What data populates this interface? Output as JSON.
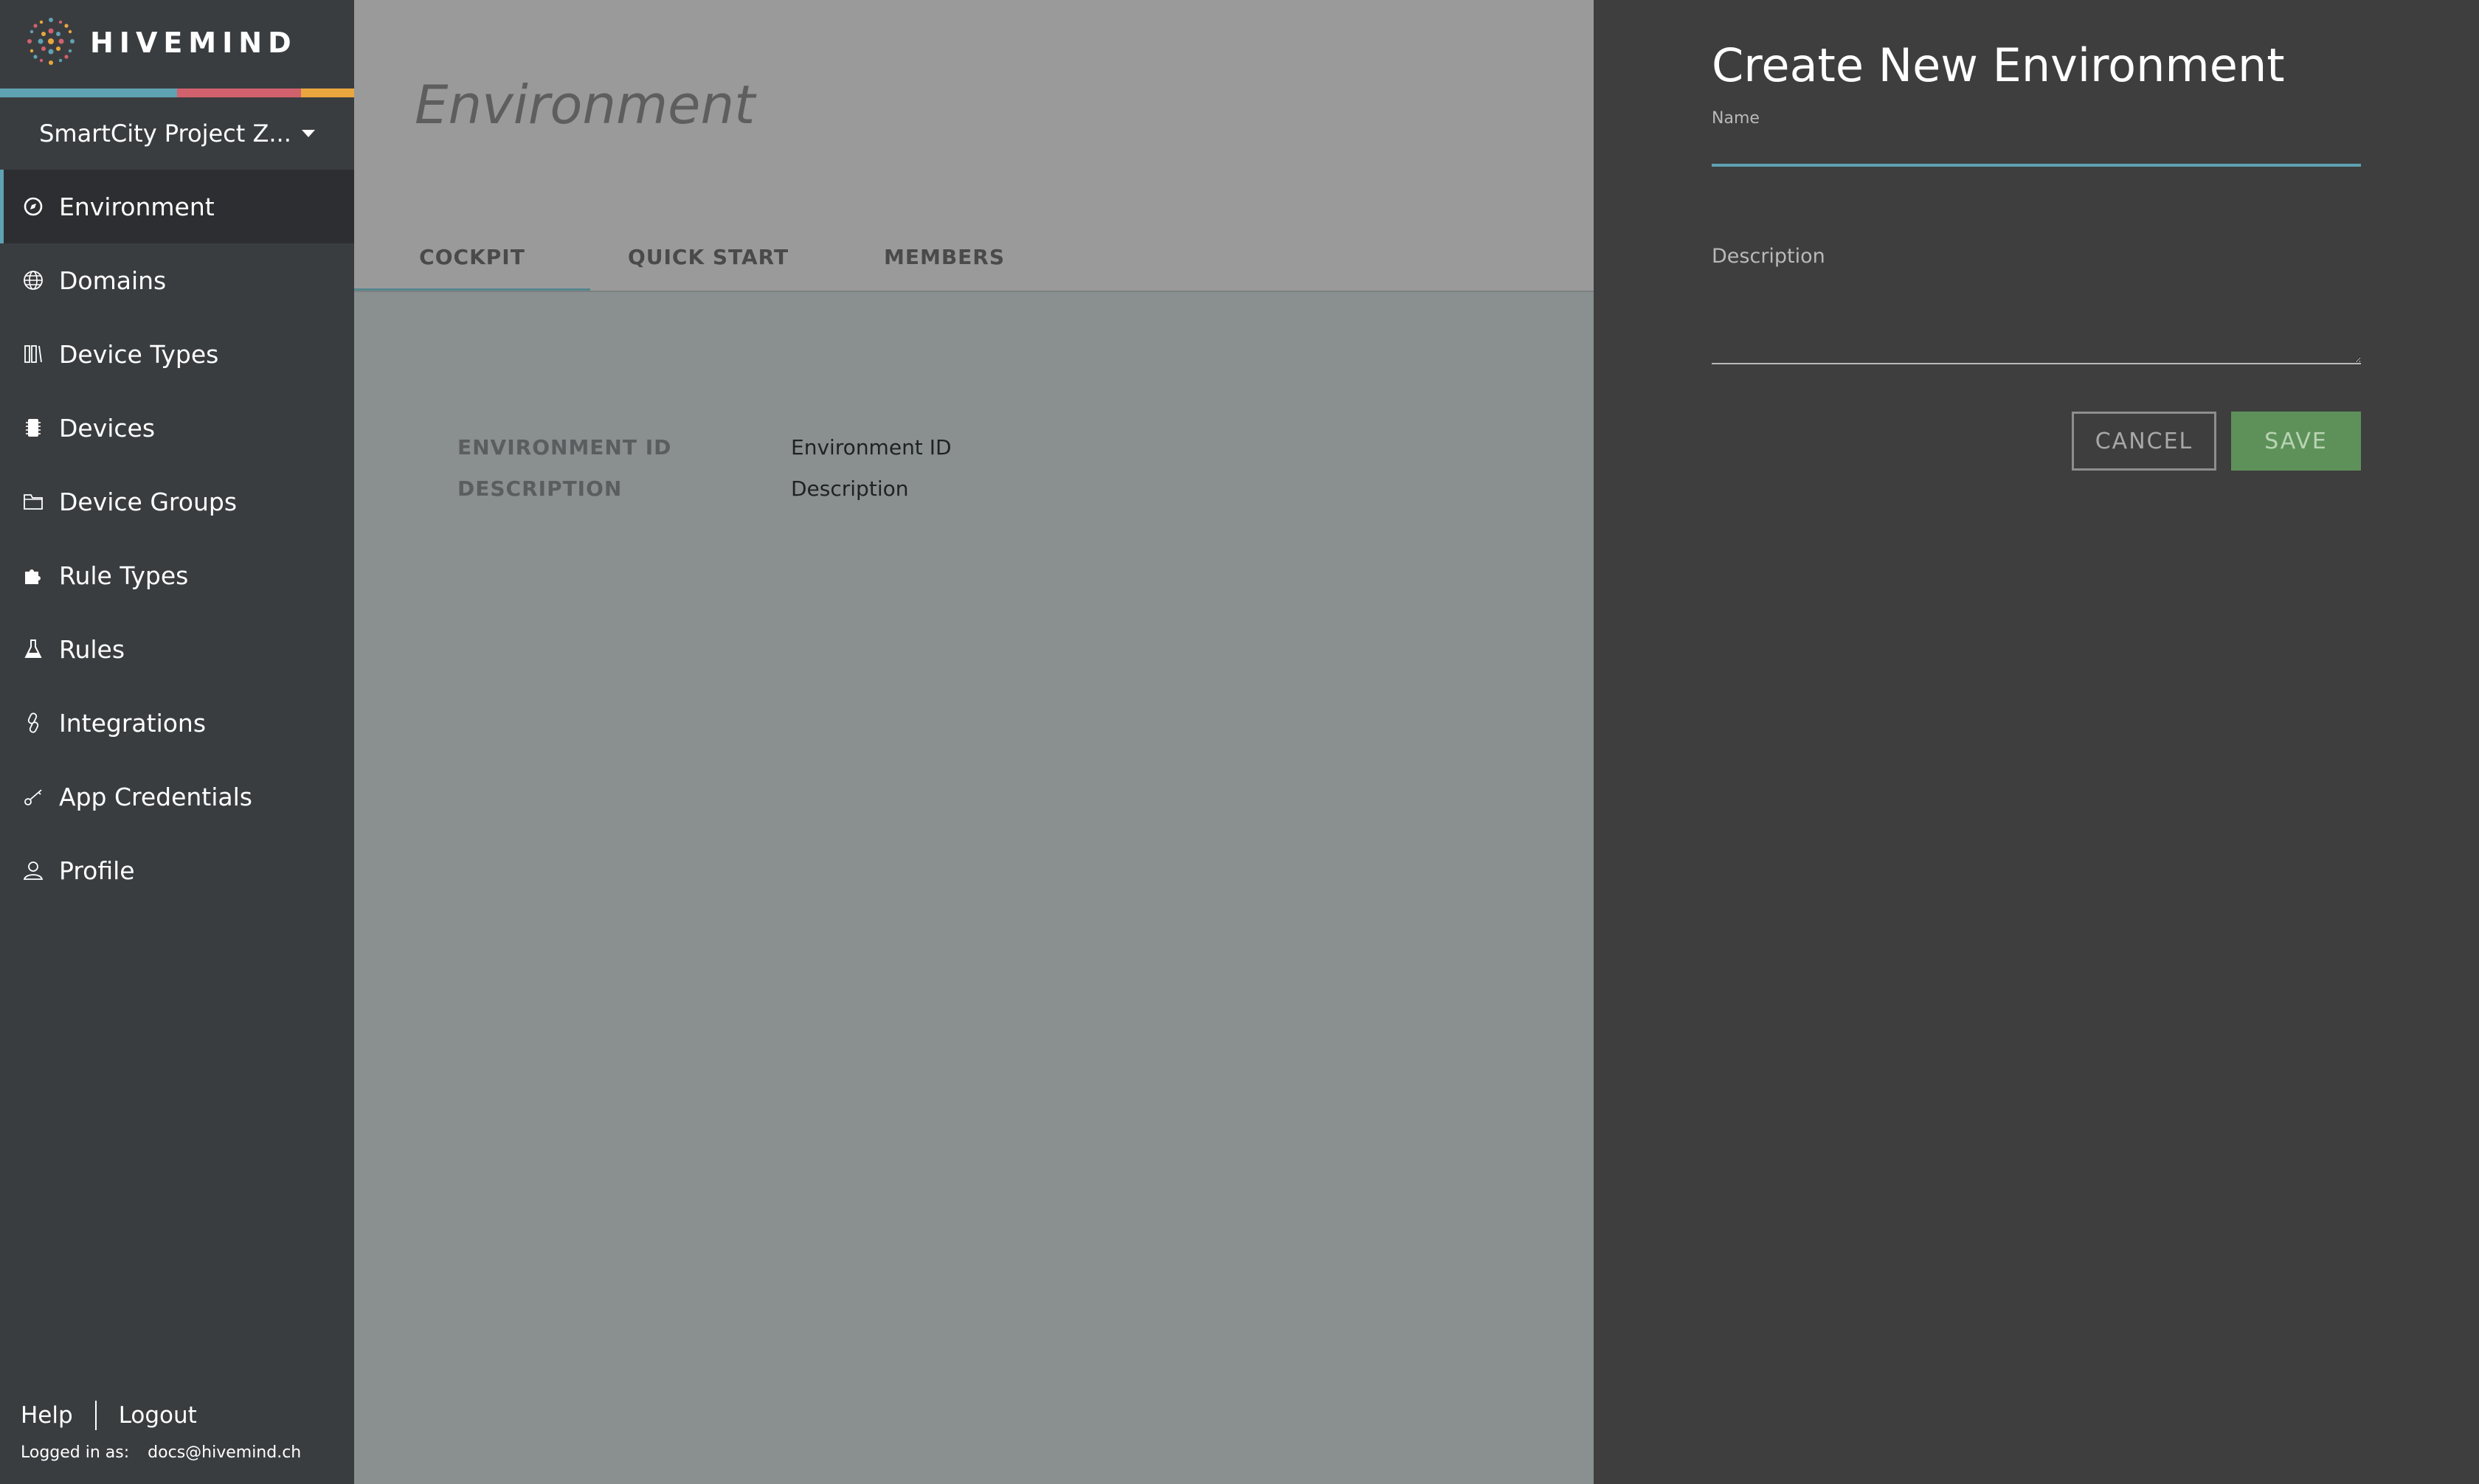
{
  "brand": {
    "name": "HIVEMIND",
    "stripe_colors": [
      "#5fa2b3",
      "#d2616e",
      "#e9a73e"
    ]
  },
  "sidebar": {
    "project": "SmartCity Project Z...",
    "items": [
      {
        "label": "Environment",
        "icon": "compass-icon",
        "active": true
      },
      {
        "label": "Domains",
        "icon": "globe-icon",
        "active": false
      },
      {
        "label": "Device Types",
        "icon": "device-types-icon",
        "active": false
      },
      {
        "label": "Devices",
        "icon": "chip-icon",
        "active": false
      },
      {
        "label": "Device Groups",
        "icon": "folder-icon",
        "active": false
      },
      {
        "label": "Rule Types",
        "icon": "puzzle-icon",
        "active": false
      },
      {
        "label": "Rules",
        "icon": "flask-icon",
        "active": false
      },
      {
        "label": "Integrations",
        "icon": "link-icon",
        "active": false
      },
      {
        "label": "App Credentials",
        "icon": "key-icon",
        "active": false
      },
      {
        "label": "Profile",
        "icon": "user-icon",
        "active": false
      }
    ],
    "footer": {
      "help": "Help",
      "logout": "Logout",
      "logged_in_label": "Logged in as:",
      "user": "docs@hivemind.ch"
    }
  },
  "main": {
    "title": "Environment",
    "tabs": [
      {
        "label": "COCKPIT",
        "active": true
      },
      {
        "label": "QUICK START",
        "active": false
      },
      {
        "label": "MEMBERS",
        "active": false
      }
    ],
    "details": [
      {
        "label": "ENVIRONMENT ID",
        "value": "Environment ID"
      },
      {
        "label": "DESCRIPTION",
        "value": "Description"
      }
    ]
  },
  "panel": {
    "title": "Create New Environment",
    "name_label": "Name",
    "name_value": "",
    "description_label": "Description",
    "description_value": "",
    "cancel_label": "CANCEL",
    "save_label": "SAVE"
  }
}
